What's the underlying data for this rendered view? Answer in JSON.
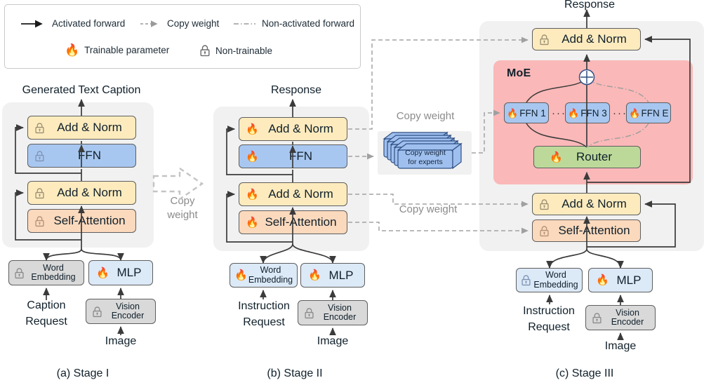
{
  "legend": {
    "items": [
      {
        "id": "activated-forward",
        "label": "Activated forward",
        "icon": "solid-arrow"
      },
      {
        "id": "copy-weight",
        "label": "Copy weight",
        "icon": "dashed-arrow"
      },
      {
        "id": "non-activated-forward",
        "label": "Non-activated forward",
        "icon": "dash-dot-line"
      },
      {
        "id": "trainable-parameter",
        "label": "Trainable parameter",
        "icon": "flame-icon"
      },
      {
        "id": "non-trainable",
        "label": "Non-trainable",
        "icon": "lock-icon"
      }
    ]
  },
  "colors": {
    "yellow": "#fdebbe",
    "blue": "#a8c7f0",
    "orange": "#fbd9bd",
    "gray": "#d9d9d9",
    "light_blue": "#dce9f7",
    "green": "#bdd99a",
    "moe_pink": "#fbb8b8",
    "panel_gray": "#f1f1f1",
    "stroke": "#5e5e5e",
    "dashed_gray": "#9a9a9a"
  },
  "stage1": {
    "caption": "(a) Stage I",
    "output_label": "Generated Text Caption",
    "blocks": [
      {
        "id": "add-norm-top",
        "label": "Add & Norm",
        "state": "non-trainable",
        "color": "yellow"
      },
      {
        "id": "ffn",
        "label": "FFN",
        "state": "non-trainable",
        "color": "blue"
      },
      {
        "id": "add-norm-bottom",
        "label": "Add & Norm",
        "state": "non-trainable",
        "color": "yellow"
      },
      {
        "id": "self-attention",
        "label": "Self-Attention",
        "state": "non-trainable",
        "color": "orange"
      }
    ],
    "word_embedding": {
      "label": "Word\nEmbedding",
      "line1": "Word",
      "line2": "Embedding",
      "state": "non-trainable",
      "color": "gray"
    },
    "mlp": {
      "label": "MLP",
      "state": "trainable",
      "color": "light_blue"
    },
    "vision_encoder": {
      "line1": "Vision",
      "line2": "Encoder",
      "state": "non-trainable",
      "color": "gray"
    },
    "input_text": {
      "line1": "Caption",
      "line2": "Request"
    },
    "image_label": "Image"
  },
  "stage2": {
    "caption": "(b) Stage II",
    "output_label": "Response",
    "blocks": [
      {
        "id": "add-norm-top",
        "label": "Add & Norm",
        "state": "trainable",
        "color": "yellow"
      },
      {
        "id": "ffn",
        "label": "FFN",
        "state": "trainable",
        "color": "blue"
      },
      {
        "id": "add-norm-bottom",
        "label": "Add & Norm",
        "state": "trainable",
        "color": "yellow"
      },
      {
        "id": "self-attention",
        "label": "Self-Attention",
        "state": "trainable",
        "color": "orange"
      }
    ],
    "word_embedding": {
      "line1": "Word",
      "line2": "Embedding",
      "state": "trainable",
      "color": "light_blue"
    },
    "mlp": {
      "label": "MLP",
      "state": "trainable",
      "color": "light_blue"
    },
    "vision_encoder": {
      "line1": "Vision",
      "line2": "Encoder",
      "state": "non-trainable",
      "color": "gray"
    },
    "input_text": {
      "line1": "Instruction",
      "line2": "Request"
    },
    "image_label": "Image"
  },
  "stage3": {
    "caption": "(c) Stage III",
    "output_label": "Response",
    "moe_label": "MoE",
    "blocks": [
      {
        "id": "add-norm-top",
        "label": "Add & Norm",
        "state": "non-trainable",
        "color": "yellow"
      },
      {
        "id": "add-norm-bottom",
        "label": "Add & Norm",
        "state": "non-trainable",
        "color": "yellow"
      },
      {
        "id": "self-attention",
        "label": "Self-Attention",
        "state": "non-trainable",
        "color": "orange"
      }
    ],
    "experts": [
      {
        "id": "ffn-1",
        "label": "FFN 1",
        "state": "trainable",
        "activated": true
      },
      {
        "id": "ffn-3",
        "label": "FFN 3",
        "state": "trainable",
        "activated": true
      },
      {
        "id": "ffn-e",
        "label": "FFN E",
        "state": "trainable",
        "activated": false
      }
    ],
    "expert_ellipsis": "···",
    "router": {
      "label": "Router",
      "state": "trainable",
      "color": "green"
    },
    "sum_symbol": "⊕",
    "word_embedding": {
      "line1": "Word",
      "line2": "Embedding",
      "state": "non-trainable",
      "color": "light_blue"
    },
    "mlp": {
      "label": "MLP",
      "state": "trainable",
      "color": "light_blue"
    },
    "vision_encoder": {
      "line1": "Vision",
      "line2": "Encoder",
      "state": "non-trainable",
      "color": "gray"
    },
    "input_text": {
      "line1": "Instruction",
      "line2": "Request"
    },
    "image_label": "Image"
  },
  "transfers": {
    "stage1_to_stage2": {
      "label_line1": "Copy",
      "label_line2": "weight",
      "arrow": "block-dashed-arrow"
    },
    "copy_weight_top": "Copy weight",
    "copy_weight_bottom": "Copy weight",
    "experts_stack": {
      "line1": "Copy weight",
      "line2": "for experts"
    }
  }
}
